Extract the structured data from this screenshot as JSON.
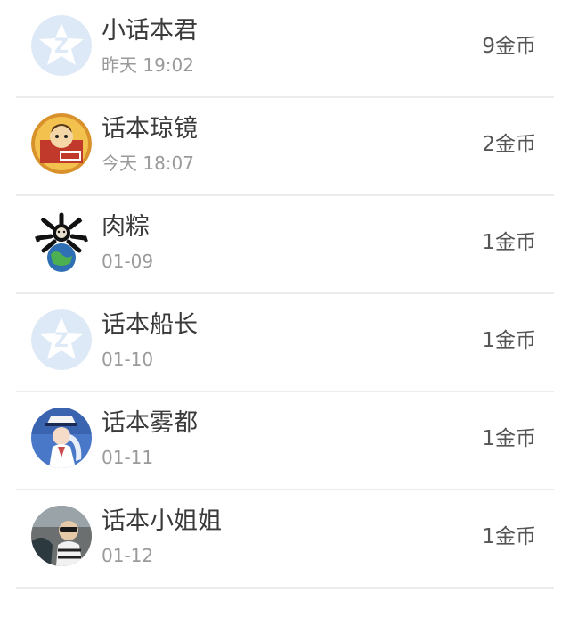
{
  "records": [
    {
      "name": "小话本君",
      "time": "昨天 19:02",
      "coins": "9金币",
      "avatar_icon": "qq-default-avatar"
    },
    {
      "name": "话本琼镜",
      "time": "今天 18:07",
      "coins": "2金币",
      "avatar_icon": "cartoon-avatar"
    },
    {
      "name": "肉粽",
      "time": "01-09",
      "coins": "1金币",
      "avatar_icon": "meme-globe-avatar"
    },
    {
      "name": "话本船长",
      "time": "01-10",
      "coins": "1金币",
      "avatar_icon": "qq-default-avatar"
    },
    {
      "name": "话本雾都",
      "time": "01-11",
      "coins": "1金币",
      "avatar_icon": "anime-character-avatar"
    },
    {
      "name": "话本小姐姐",
      "time": "01-12",
      "coins": "1金币",
      "avatar_icon": "photo-avatar"
    }
  ],
  "colors": {
    "divider": "#ececec",
    "name_text": "#3a3a3a",
    "time_text": "#9a9a9a",
    "coins_text": "#555555",
    "default_avatar_bg": "#dde9f6"
  }
}
